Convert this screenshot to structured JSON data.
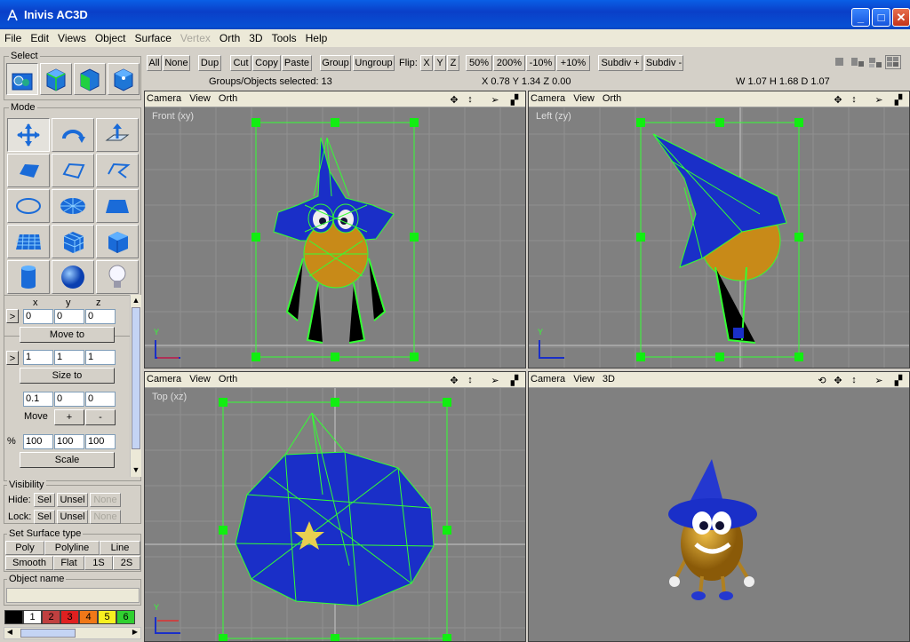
{
  "window": {
    "title": "Inivis AC3D"
  },
  "menu": [
    "File",
    "Edit",
    "Views",
    "Object",
    "Surface",
    "Vertex",
    "Orth",
    "3D",
    "Tools",
    "Help"
  ],
  "menu_disabled": "Vertex",
  "select": {
    "label": "Select"
  },
  "mode": {
    "label": "Mode"
  },
  "coords": {
    "axis_x": "x",
    "axis_y": "y",
    "axis_z": "z",
    "move_to": [
      "0",
      "0",
      "0"
    ],
    "move_to_button": "Move to",
    "size_to": [
      "1",
      "1",
      "1"
    ],
    "size_to_button": "Size to",
    "move": [
      "0.1",
      "0",
      "0"
    ],
    "move_label": "Move",
    "move_plus": "+",
    "move_minus": "-",
    "percent_label": "%",
    "scale": [
      "100",
      "100",
      "100"
    ],
    "scale_button": "Scale",
    "arrow": ">"
  },
  "visibility": {
    "label": "Visibility",
    "hide_label": "Hide:",
    "lock_label": "Lock:",
    "sel": "Sel",
    "unsel": "Unsel",
    "none": "None"
  },
  "surface": {
    "label": "Set Surface type",
    "poly": "Poly",
    "polyline": "Polyline",
    "line": "Line",
    "smooth": "Smooth",
    "flat": "Flat",
    "s1": "1S",
    "s2": "2S"
  },
  "object_name": {
    "label": "Object name",
    "value": ""
  },
  "palette": [
    {
      "label": "",
      "color": "#000000"
    },
    {
      "label": "1",
      "color": "#ffffff"
    },
    {
      "label": "2",
      "color": "#c04040"
    },
    {
      "label": "3",
      "color": "#e02020"
    },
    {
      "label": "4",
      "color": "#f07818"
    },
    {
      "label": "5",
      "color": "#f8f020"
    },
    {
      "label": "6",
      "color": "#30d030"
    }
  ],
  "toolbar": {
    "all": "All",
    "none": "None",
    "dup": "Dup",
    "cut": "Cut",
    "copy": "Copy",
    "paste": "Paste",
    "group": "Group",
    "ungroup": "Ungroup",
    "flip": "Flip:",
    "fx": "X",
    "fy": "Y",
    "fz": "Z",
    "z50": "50%",
    "z200": "200%",
    "zm10": "-10%",
    "zp10": "+10%",
    "subdiv_plus": "Subdiv +",
    "subdiv_minus": "Subdiv -"
  },
  "status": {
    "selected": "Groups/Objects selected: 13",
    "position": "X 0.78 Y 1.34 Z 0.00",
    "dims": "W 1.07 H 1.68 D 1.07"
  },
  "viewports": [
    {
      "camera": "Camera",
      "view": "View",
      "mode": "Orth",
      "label": "Front (xy)"
    },
    {
      "camera": "Camera",
      "view": "View",
      "mode": "Orth",
      "label": "Left (zy)"
    },
    {
      "camera": "Camera",
      "view": "View",
      "mode": "Orth",
      "label": "Top (xz)"
    },
    {
      "camera": "Camera",
      "view": "View",
      "mode": "3D",
      "label": ""
    }
  ],
  "colors": {
    "wire": "#33ff33",
    "hat": "#1a2fc8",
    "body": "#d09018",
    "bg": "#808080"
  }
}
